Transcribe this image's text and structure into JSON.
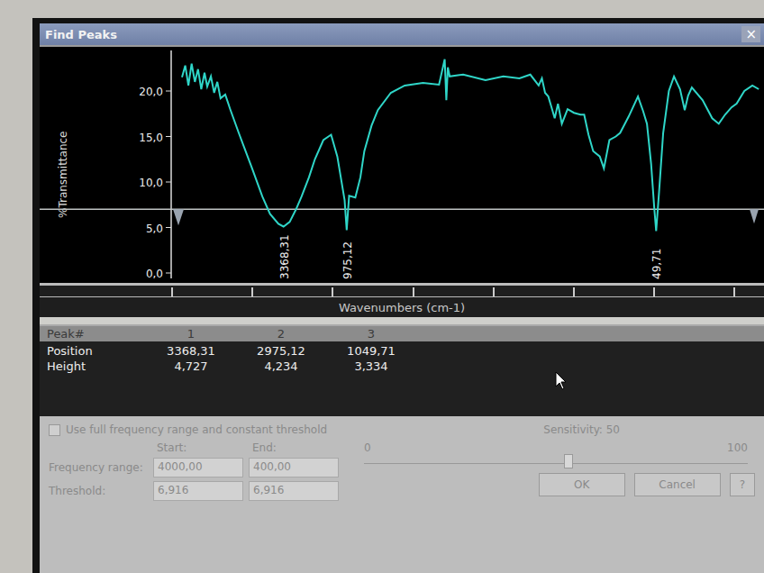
{
  "window": {
    "title": "Find Peaks",
    "close": "×"
  },
  "spectrum": {
    "y_label": "%Transmittance",
    "y_ticks": [
      "20,0",
      "15,0",
      "10,0",
      "5,0",
      "0,0"
    ],
    "x_label": "Wavenumbers (cm-1)",
    "threshold": 7.0,
    "series": {
      "wavenumbers": [
        4000,
        3980,
        3960,
        3940,
        3920,
        3900,
        3880,
        3860,
        3843,
        3820,
        3800,
        3780,
        3760,
        3731,
        3700,
        3647,
        3600,
        3564,
        3500,
        3452,
        3400,
        3368,
        3330,
        3290,
        3256,
        3210,
        3173,
        3120,
        3072,
        3033,
        2988,
        2975,
        2960,
        2921,
        2890,
        2865,
        2820,
        2781,
        2700,
        2614,
        2500,
        2400,
        2365,
        2355,
        2345,
        2334,
        2250,
        2111,
        2000,
        1900,
        1832,
        1780,
        1760,
        1740,
        1720,
        1700,
        1680,
        1660,
        1636,
        1600,
        1560,
        1520,
        1497,
        1470,
        1441,
        1400,
        1374,
        1340,
        1300,
        1273,
        1220,
        1162,
        1130,
        1106,
        1080,
        1060,
        1049,
        1030,
        1005,
        970,
        938,
        900,
        871,
        850,
        827,
        760,
        700,
        659,
        620,
        580,
        548,
        500,
        450,
        410
      ],
      "transmittance": [
        21.5,
        22.8,
        20.6,
        23.0,
        21.0,
        22.4,
        20.2,
        22.0,
        20.5,
        21.6,
        19.8,
        21.0,
        19.2,
        19.6,
        18.0,
        15.4,
        13.2,
        11.5,
        8.4,
        6.5,
        5.4,
        5.1,
        5.6,
        7.0,
        8.4,
        10.5,
        12.5,
        14.6,
        15.2,
        12.8,
        8.0,
        4.7,
        8.5,
        8.3,
        10.5,
        13.4,
        16.2,
        17.9,
        19.8,
        20.6,
        20.9,
        20.7,
        23.5,
        19.0,
        22.6,
        21.6,
        21.8,
        21.2,
        21.6,
        21.4,
        21.8,
        20.6,
        21.4,
        19.8,
        19.4,
        18.2,
        17.0,
        18.6,
        16.4,
        18.0,
        17.6,
        17.4,
        17.4,
        15.2,
        13.4,
        12.8,
        11.5,
        14.6,
        15.0,
        15.4,
        17.2,
        19.4,
        17.8,
        16.4,
        12.0,
        7.0,
        4.6,
        9.0,
        15.4,
        20.0,
        21.6,
        20.2,
        17.9,
        19.5,
        20.4,
        19.0,
        17.0,
        16.4,
        17.4,
        18.2,
        18.6,
        20.0,
        20.6,
        20.2
      ]
    },
    "peak_labels": [
      {
        "text": "3368,31",
        "wavenumber": 3368.31
      },
      {
        "text": "975,12",
        "wavenumber": 2975.12
      },
      {
        "text": "49,71",
        "wavenumber": 1049.71
      }
    ]
  },
  "table": {
    "columns": [
      "Peak#",
      "1",
      "2",
      "3"
    ],
    "rows": [
      {
        "label": "Position",
        "values": [
          "3368,31",
          "2975,12",
          "1049,71"
        ]
      },
      {
        "label": "Height",
        "values": [
          "4,727",
          "4,234",
          "3,334"
        ]
      }
    ]
  },
  "controls": {
    "full_range": {
      "label": "Use full frequency range and constant threshold",
      "checked": false
    },
    "sensitivity": {
      "label": "Sensitivity: 50",
      "min": "0",
      "max": "100",
      "level": 0.52
    },
    "headers": [
      "Start:",
      "End:"
    ],
    "fields": [
      {
        "label": "Frequency range:",
        "values": [
          "4000,00",
          "400,00"
        ]
      },
      {
        "label": "Threshold:",
        "values": [
          "6,916",
          "6,916"
        ]
      }
    ],
    "buttons": [
      "OK",
      "Cancel",
      "?"
    ]
  }
}
